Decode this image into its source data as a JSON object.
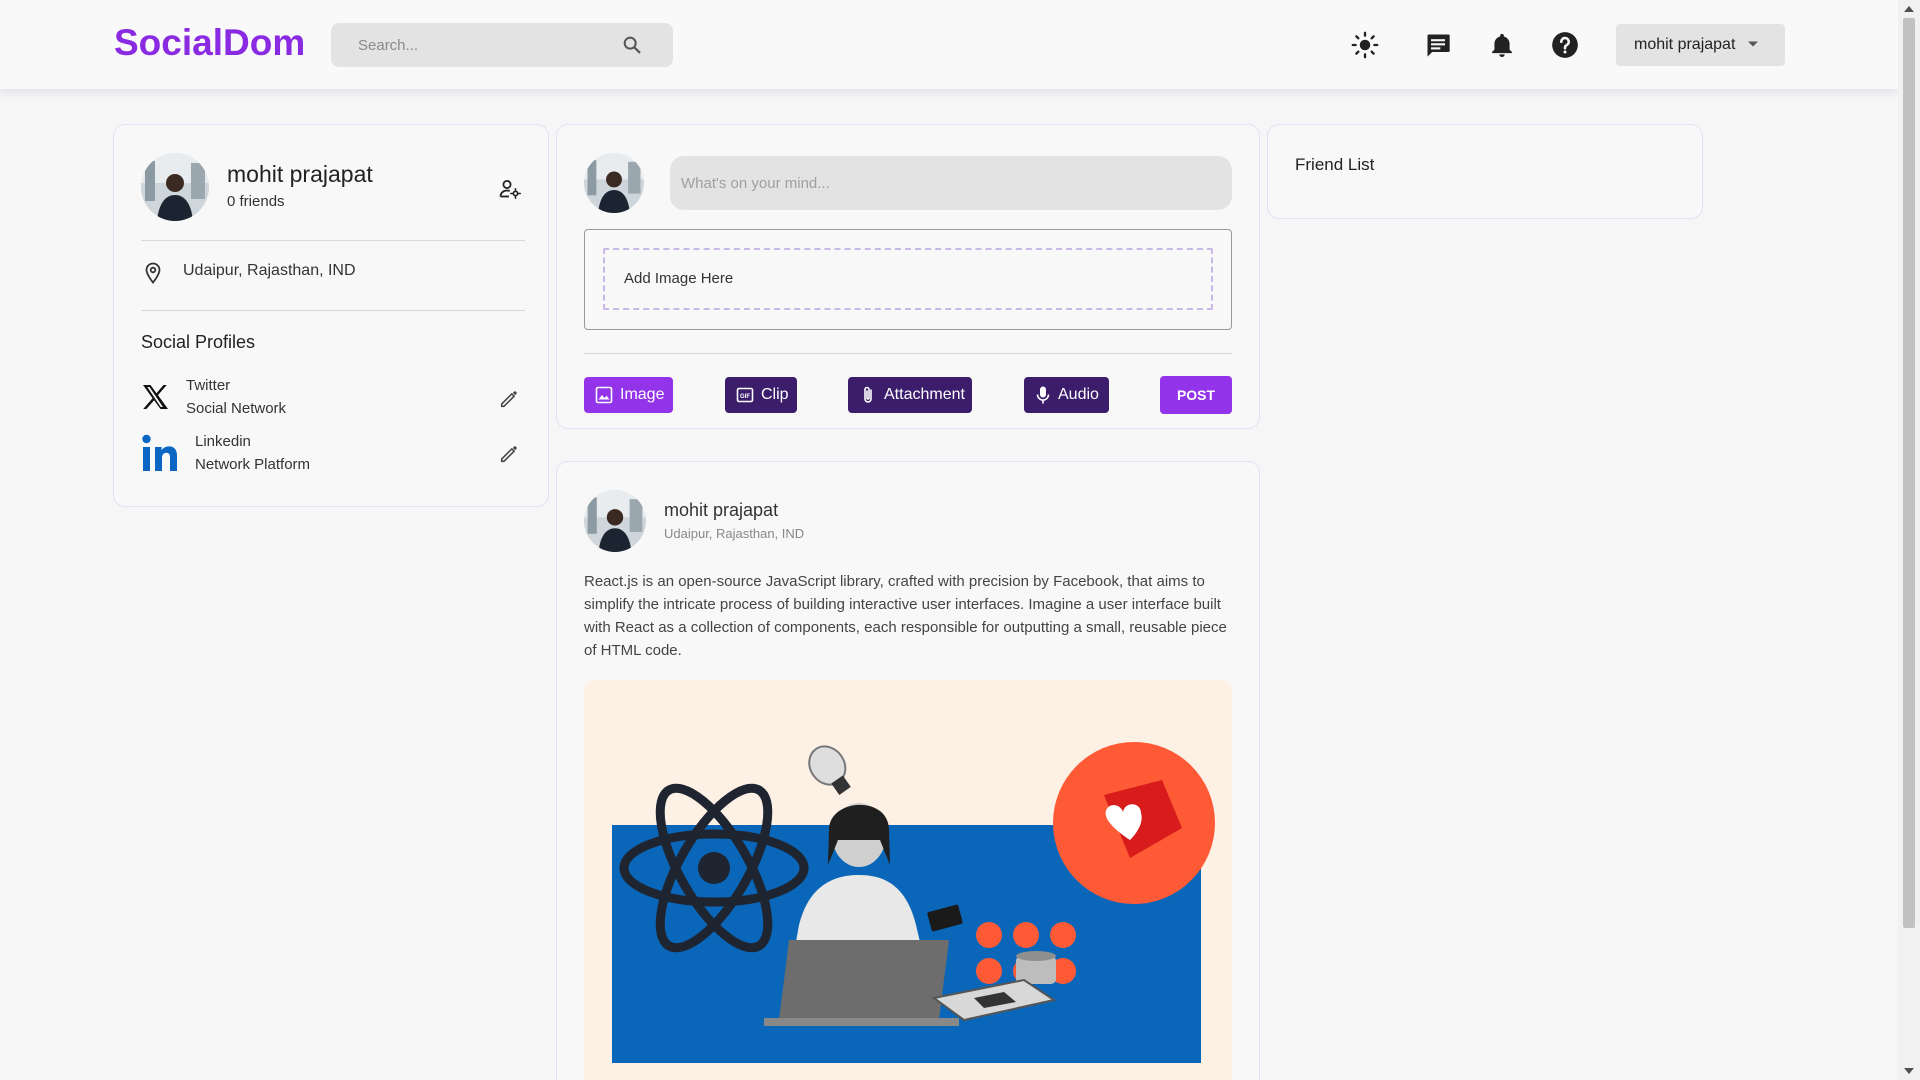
{
  "header": {
    "logo": "SocialDom",
    "search_placeholder": "Search...",
    "user_name": "mohit prajapat"
  },
  "profile": {
    "name": "mohit prajapat",
    "friends": "0 friends",
    "location": "Udaipur, Rajasthan, IND",
    "social_title": "Social Profiles",
    "social": [
      {
        "name": "Twitter",
        "sub": "Social Network"
      },
      {
        "name": "Linkedin",
        "sub": "Network Platform"
      }
    ]
  },
  "composer": {
    "placeholder": "What's on your mind...",
    "dropzone": "Add Image Here",
    "buttons": {
      "image": "Image",
      "clip": "Clip",
      "attachment": "Attachment",
      "audio": "Audio",
      "post": "POST"
    }
  },
  "post": {
    "author": "mohit prajapat",
    "location": "Udaipur, Rajasthan, IND",
    "text": "React.js is an open-source JavaScript library, crafted with precision by Facebook, that aims to simplify the intricate process of building interactive user interfaces. Imagine a user interface built with React as a collection of components, each responsible for outputting a small, reusable piece of HTML code."
  },
  "friends": {
    "title": "Friend List"
  },
  "colors": {
    "brand": "#8a2be2",
    "primary_button": "#9333ea",
    "dark_button": "#3b1d6b",
    "react_blue": "#0a66b8",
    "heart_orange": "#ff5a36"
  }
}
